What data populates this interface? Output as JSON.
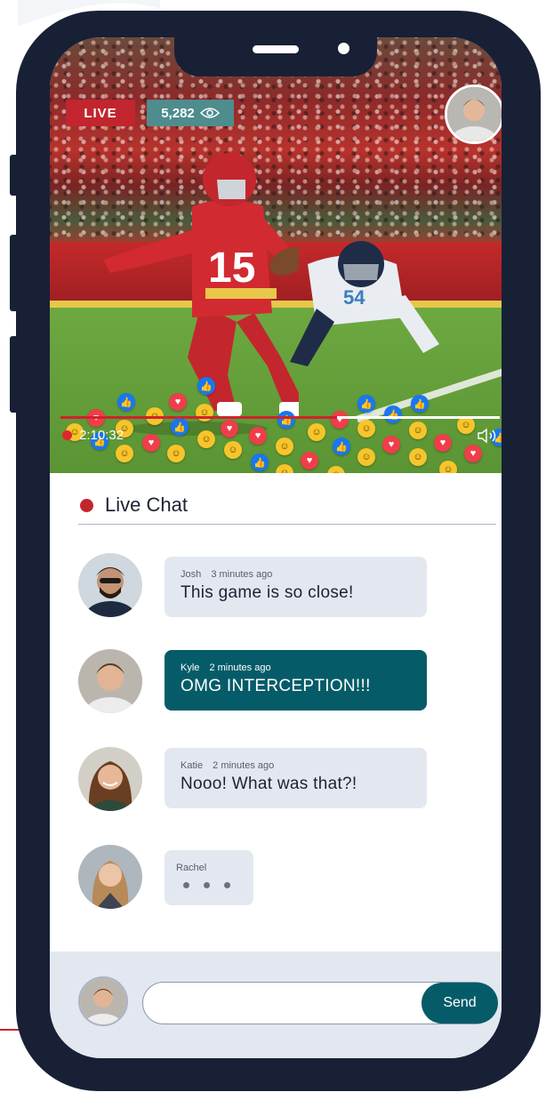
{
  "video": {
    "live_label": "LIVE",
    "viewer_count": "5,282",
    "elapsed": "2:10:32",
    "progress_fraction": 0.63,
    "jersey_number": "15",
    "opponent_number": "54",
    "icons": [
      "eye-icon",
      "volume-icon",
      "heart-icon",
      "like-icon",
      "smile-icon"
    ]
  },
  "chat": {
    "title": "Live Chat",
    "messages": [
      {
        "author": "Josh",
        "time": "3 minutes ago",
        "text": "This game is so close!"
      },
      {
        "author": "Kyle",
        "time": "2 minutes ago",
        "text": "OMG INTERCEPTION!!!"
      },
      {
        "author": "Katie",
        "time": "2 minutes ago",
        "text": "Nooo! What was that?!"
      }
    ],
    "typing": {
      "author": "Rachel"
    }
  },
  "composer": {
    "placeholder": "",
    "send_label": "Send"
  },
  "colors": {
    "frame": "#182036",
    "live_red": "#c2252d",
    "viewer_teal": "#4e8c8e",
    "accent": "#055c68",
    "bubble_light": "#e3e8f0"
  }
}
